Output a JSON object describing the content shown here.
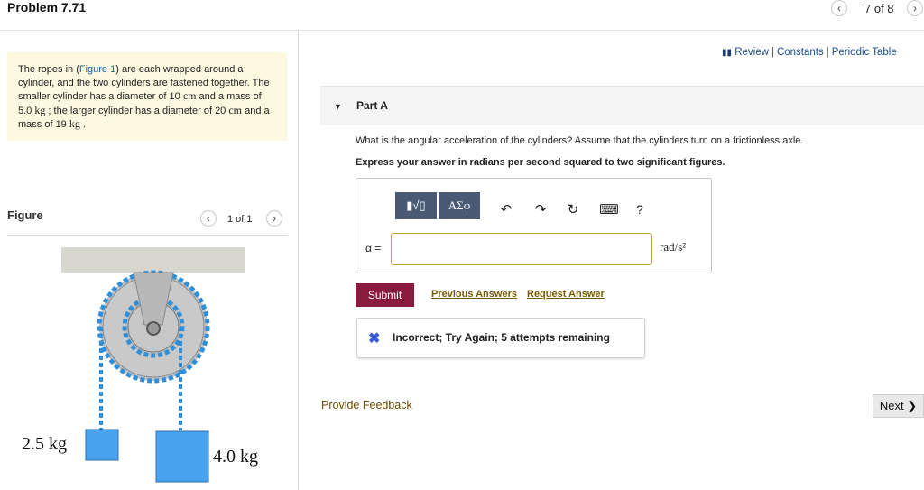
{
  "header": {
    "title": "Problem 7.71",
    "pager": "7 of 8",
    "prev_icon": "chevron-left-icon",
    "next_icon": "chevron-right-icon"
  },
  "problem": {
    "text_1": "The ropes in (",
    "figure_link": "Figure 1",
    "text_2": ") are each wrapped around a cylinder, and the two cylinders are fastened together. The smaller cylinder has a diameter of 10 ",
    "unit_cm_1": "cm",
    "text_3": " and a mass of 5.0 ",
    "unit_kg_1": "kg",
    "text_4": " ; the larger cylinder has a diameter of 20 ",
    "unit_cm_2": "cm",
    "text_5": " and a mass of 19 ",
    "unit_kg_2": "kg",
    "text_6": " ."
  },
  "figure": {
    "label": "Figure",
    "pager": "1 of 1",
    "left_mass": "2.5 kg",
    "right_mass": "4.0 kg"
  },
  "links": {
    "review": "Review",
    "sep": "|",
    "constants": "Constants",
    "periodic_table": "Periodic Table"
  },
  "part": {
    "label": "Part A",
    "question": "What is the angular acceleration of the cylinders? Assume that the cylinders turn on a frictionless axle.",
    "instruction": "Express your answer in radians per second squared to two significant figures."
  },
  "toolbar": {
    "template_btn": "▮√▯",
    "symbols_btn": "ΑΣφ",
    "undo": "↶",
    "redo": "↷",
    "reset": "↻",
    "keyboard": "⌨",
    "help": "?"
  },
  "answer": {
    "label": "α =",
    "value": "",
    "units": "rad/s²"
  },
  "actions": {
    "submit": "Submit",
    "previous_answers": "Previous Answers",
    "request_answer": "Request Answer"
  },
  "feedback": {
    "message": "Incorrect; Try Again; 5 attempts remaining"
  },
  "footer": {
    "provide_feedback": "Provide Feedback",
    "next": "Next ❯"
  },
  "colors": {
    "submit_bg": "#8a1a3e",
    "problem_bg": "#fdf9e1",
    "rope": "#2f8fd8",
    "mass_fill": "#4aa3ee"
  }
}
